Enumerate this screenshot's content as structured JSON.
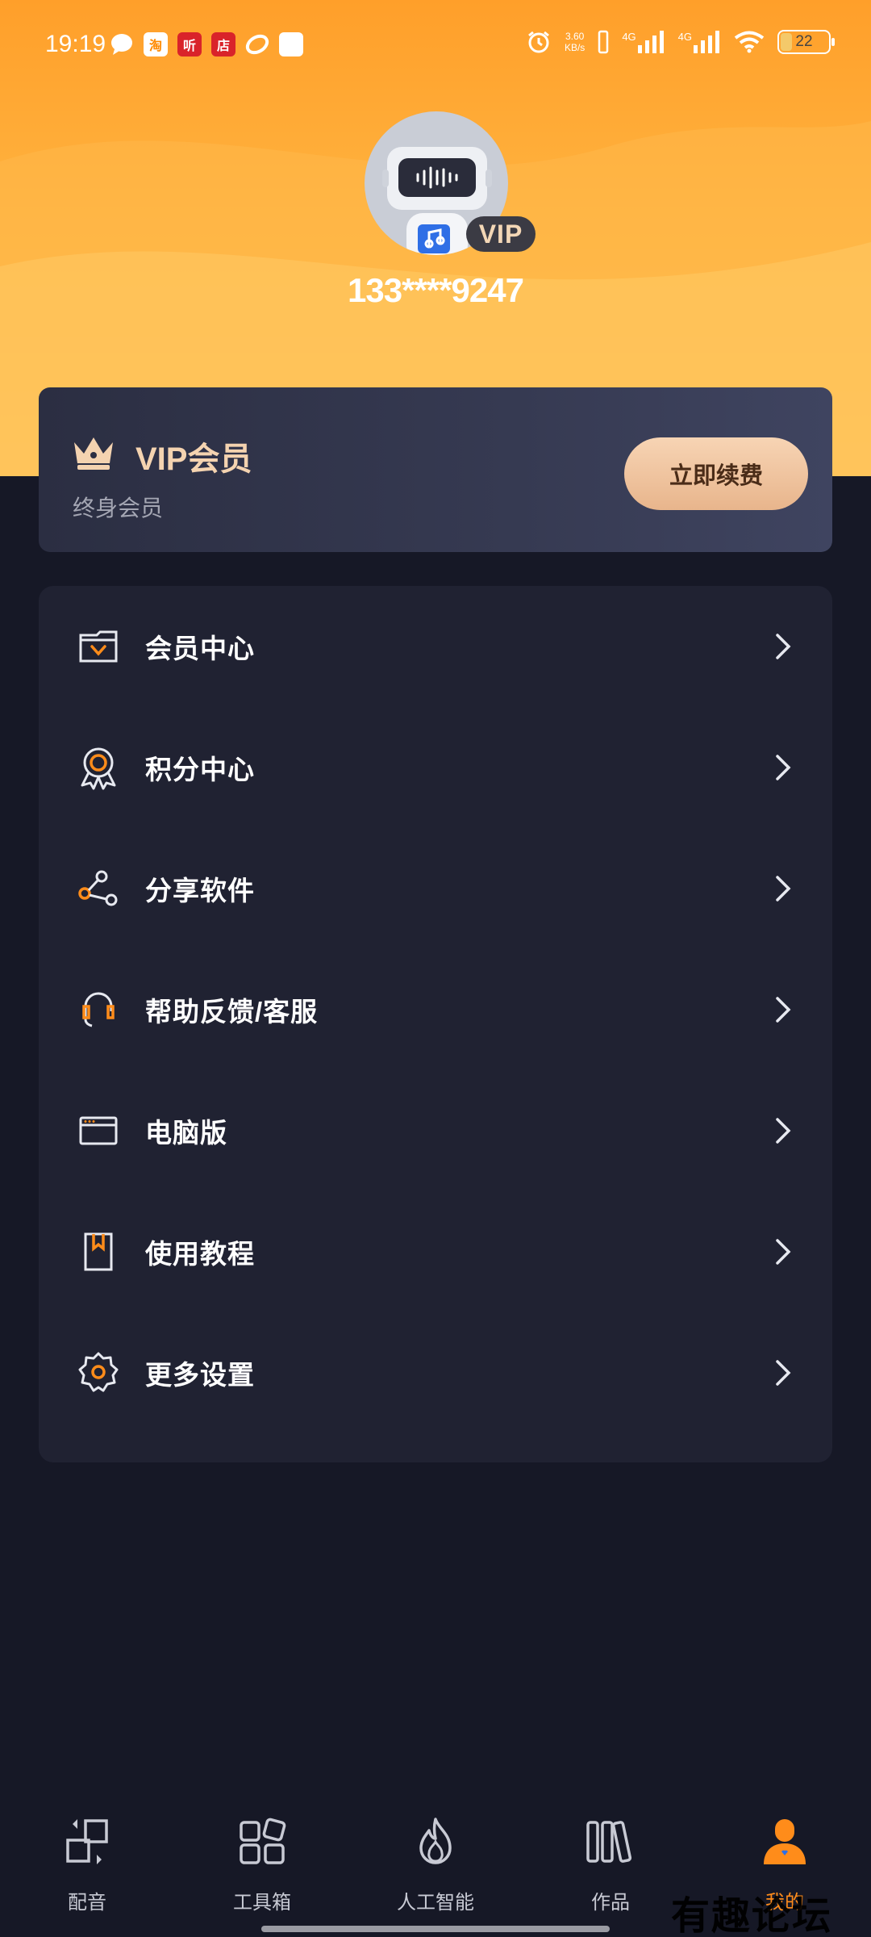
{
  "status_bar": {
    "time": "19:19",
    "app_icons": [
      "chat-icon",
      "taobao-icon",
      "ting-icon",
      "store-icon",
      "link-icon",
      "square-icon"
    ],
    "app_icon_glyphs": [
      "",
      "淘",
      "听",
      "店",
      "",
      ""
    ],
    "net_speed_value": "3.60",
    "net_speed_unit": "KB/s",
    "signal_1": "4G",
    "signal_2": "4G",
    "battery": "22"
  },
  "profile": {
    "username": "133****9247",
    "vip_tag": "VIP"
  },
  "vip_card": {
    "title": "VIP会员",
    "subtitle": "终身会员",
    "renew_button": "立即续费"
  },
  "menu": {
    "items": [
      {
        "label": "会员中心",
        "icon": "member-center-icon"
      },
      {
        "label": "积分中心",
        "icon": "points-badge-icon"
      },
      {
        "label": "分享软件",
        "icon": "share-icon"
      },
      {
        "label": "帮助反馈/客服",
        "icon": "headset-icon"
      },
      {
        "label": "电脑版",
        "icon": "desktop-icon"
      },
      {
        "label": "使用教程",
        "icon": "bookmark-icon"
      },
      {
        "label": "更多设置",
        "icon": "gear-icon"
      }
    ]
  },
  "bottom_nav": {
    "items": [
      {
        "label": "配音",
        "icon": "dubbing-icon",
        "active": false
      },
      {
        "label": "工具箱",
        "icon": "toolbox-icon",
        "active": false
      },
      {
        "label": "人工智能",
        "icon": "ai-flame-icon",
        "active": false
      },
      {
        "label": "作品",
        "icon": "works-icon",
        "active": false
      },
      {
        "label": "我的",
        "icon": "profile-icon",
        "active": true
      }
    ]
  },
  "watermark": "有趣论坛",
  "colors": {
    "accent": "#ff8c1a",
    "header_top": "#ff9f2a",
    "header_bottom": "#ffc75a",
    "background": "#161826",
    "card": "#202232",
    "vip_gold": "#f4d3b0"
  }
}
